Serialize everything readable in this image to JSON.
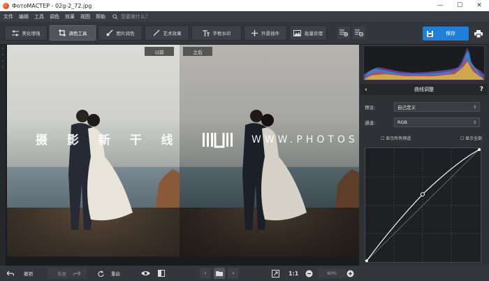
{
  "window": {
    "title": "ФотоМАСТЕР - 02g-2_72.jpg",
    "minimize": "—",
    "maximize": "☐",
    "close": "✕"
  },
  "menu": {
    "items": [
      "文件",
      "编辑",
      "工具",
      "调色",
      "效果",
      "视图",
      "帮助"
    ],
    "search_placeholder": "您要做什么？"
  },
  "toolbar": {
    "tabs": [
      {
        "label": "美化增强",
        "icon": "sliders-icon"
      },
      {
        "label": "调色工具",
        "icon": "crop-icon"
      },
      {
        "label": "图片润色",
        "icon": "brush-icon"
      },
      {
        "label": "艺术效果",
        "icon": "magic-wand-icon"
      },
      {
        "label": "字框水印",
        "icon": "text-icon"
      },
      {
        "label": "外景插件",
        "icon": "plus-icon"
      },
      {
        "label": "批量处理",
        "icon": "batch-icon"
      }
    ],
    "save_label": "保存"
  },
  "canvas": {
    "before_label": "以前",
    "after_label": "之后",
    "watermark_cn": "摄 影 新 干 线",
    "watermark_en": "WWW.PHOTOSKS.VIP"
  },
  "panel": {
    "title": "曲线调整",
    "preset_label": "预设:",
    "preset_value": "自己定义",
    "channel_label": "通道:",
    "channel_value": "RGB",
    "check_left": "显示所有频道",
    "check_right": "显示全部"
  },
  "bottom": {
    "undo": "撤销",
    "redo": "恢复",
    "reset": "重启",
    "ratio": "1:1",
    "zoom": "60%"
  },
  "colors": {
    "accent": "#1f7fd9",
    "bg": "#2b2e33"
  }
}
